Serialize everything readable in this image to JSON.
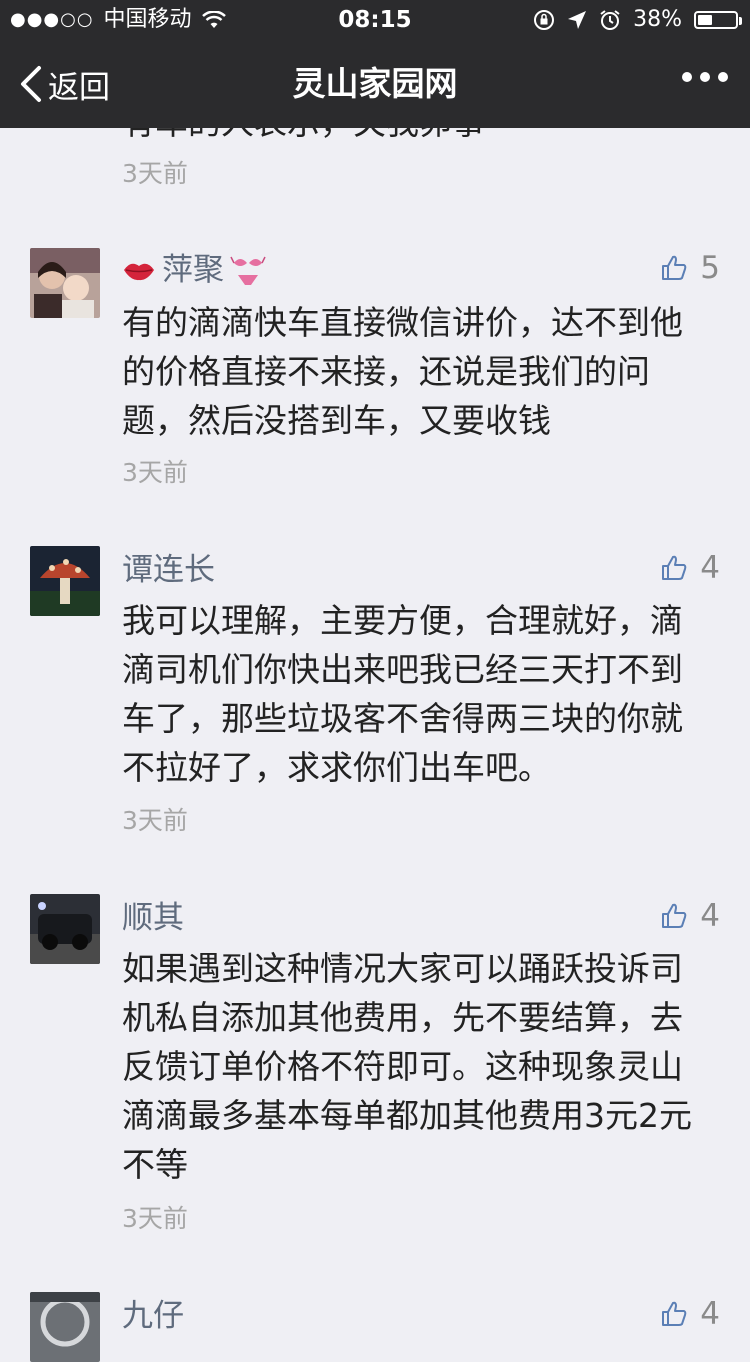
{
  "status_bar": {
    "signal": "●●●○○",
    "carrier": "中国移动",
    "time": "08:15",
    "battery": "38%"
  },
  "nav": {
    "back_label": "返回",
    "title": "灵山家园网"
  },
  "partial_comment": {
    "text": "有车的人表示，关我卵事",
    "time": "3天前"
  },
  "comments": [
    {
      "name": "萍聚",
      "likes": "5",
      "text": "有的滴滴快车直接微信讲价，达不到他的价格直接不来接，还说是我们的问题，然后没搭到车，又要收钱",
      "time": "3天前"
    },
    {
      "name": "谭连长",
      "likes": "4",
      "text": "我可以理解，主要方便，合理就好，滴滴司机们你快出来吧我已经三天打不到车了，那些垃圾客不舍得两三块的你就不拉好了，求求你们出车吧。",
      "time": "3天前"
    },
    {
      "name": "顺其",
      "likes": "4",
      "text": "如果遇到这种情况大家可以踊跃投诉司机私自添加其他费用，先不要结算，去反馈订单价格不符即可。这种现象灵山滴滴最多基本每单都加其他费用3元2元不等",
      "time": "3天前"
    },
    {
      "name": "九仔",
      "likes": "4"
    }
  ],
  "colors": {
    "nav_bg": "#2b2b2d",
    "page_bg": "#efeff4",
    "name": "#5f6b7d",
    "like_icon": "#5b7fb5"
  }
}
